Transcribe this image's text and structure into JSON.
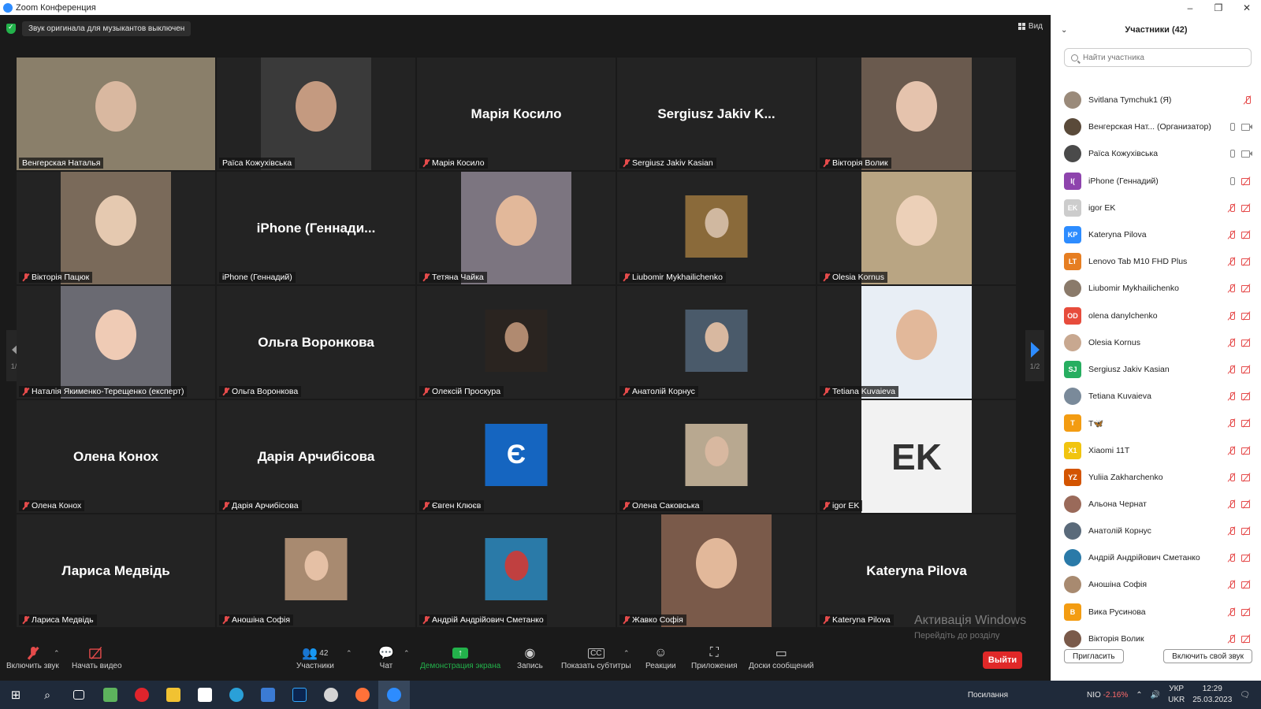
{
  "window": {
    "title": "Zoom Конференция",
    "controls": [
      "–",
      "❐",
      "✕"
    ]
  },
  "notice": "Звук оригинала для музыкантов выключен",
  "view_label": "Вид",
  "tiles": [
    {
      "bigname": "",
      "label": "Венгерская Наталья",
      "muted": false,
      "active": true,
      "photo": "full",
      "bg": "#8a7f6a",
      "face": "#d9b8a0"
    },
    {
      "bigname": "",
      "label": "Раїса Кожухівська",
      "muted": false,
      "photo": "full",
      "bg": "#3a3a3a",
      "face": "#c49a80"
    },
    {
      "bigname": "Марія Косило",
      "label": "Марія Косило",
      "muted": true
    },
    {
      "bigname": "Sergiusz Jakiv K...",
      "label": "Sergiusz Jakiv Kasian",
      "muted": true
    },
    {
      "bigname": "",
      "label": "Вікторія Волик",
      "muted": true,
      "photo": "full",
      "bg": "#6a5a4e",
      "face": "#e5c3ad"
    },
    {
      "bigname": "",
      "label": "Вікторія Пацюк",
      "muted": true,
      "photo": "full",
      "bg": "#7a6a5a",
      "face": "#e5c9b0"
    },
    {
      "bigname": "iPhone (Геннади...",
      "label": "iPhone (Геннадий)",
      "muted": false
    },
    {
      "bigname": "",
      "label": "Тетяна Чайка",
      "muted": true,
      "photo": "full",
      "bg": "#7c7580",
      "face": "#e2b89a"
    },
    {
      "bigname": "",
      "label": "Liubomir Mykhailichenko",
      "muted": true,
      "photo": "small",
      "bg": "#8a6a3a",
      "face": "#d0b8a0"
    },
    {
      "bigname": "",
      "label": "Olesia Kornus",
      "muted": true,
      "photo": "full",
      "bg": "#b9a583",
      "face": "#ecd0b8"
    },
    {
      "bigname": "",
      "label": "Наталія Якименко-Терещенко (експерт)",
      "muted": true,
      "photo": "full",
      "bg": "#6a6a72",
      "face": "#efcbb5"
    },
    {
      "bigname": "Ольга Воронкова",
      "label": "Ольга Воронкова",
      "muted": true
    },
    {
      "bigname": "",
      "label": "Олексій Проскура",
      "muted": true,
      "photo": "small",
      "bg": "#2a2420",
      "face": "#b08a70"
    },
    {
      "bigname": "",
      "label": "Анатолій Корнус",
      "muted": true,
      "photo": "small",
      "bg": "#4a5a6a",
      "face": "#d8b8a0"
    },
    {
      "bigname": "",
      "label": "Tetiana Kuvaieva",
      "muted": true,
      "photo": "full",
      "bg": "#e8eef5",
      "face": "#e2b89a"
    },
    {
      "bigname": "Олена Конох",
      "label": "Олена Конох",
      "muted": true
    },
    {
      "bigname": "Дарія Арчибісова",
      "label": "Дарія Арчибісова",
      "muted": true
    },
    {
      "bigname": "",
      "label": "Євген Клюєв",
      "muted": true,
      "photo": "small",
      "bg": "#1565c0",
      "letter": "Є"
    },
    {
      "bigname": "",
      "label": "Олена Саковська",
      "muted": true,
      "photo": "small",
      "bg": "#b8a890",
      "face": "#d8b8a0"
    },
    {
      "bigname": "",
      "label": "igor EK",
      "muted": true,
      "photo": "full",
      "bg": "#f2f2f2",
      "letter": "EK"
    },
    {
      "bigname": "Лариса Медвідь",
      "label": "Лариса Медвідь",
      "muted": true
    },
    {
      "bigname": "",
      "label": "Аношіна Софія",
      "muted": true,
      "photo": "small",
      "bg": "#a88a70",
      "face": "#e5c0a5"
    },
    {
      "bigname": "",
      "label": "Андрій Андрійович Сметанко",
      "muted": true,
      "photo": "small",
      "bg": "#2a7aa8",
      "face": "#c04040"
    },
    {
      "bigname": "",
      "label": "Жавко Софія",
      "muted": true,
      "photo": "full",
      "bg": "#7a5a4a",
      "face": "#e2b89a"
    },
    {
      "bigname": "Kateryna Pilova",
      "label": "Kateryna Pilova",
      "muted": true
    }
  ],
  "pager": {
    "left": "1/2",
    "right": "1/2"
  },
  "watermark": {
    "title": "Активація Windows",
    "text": "Перейдіть до розділу \"Настройки\", щоб активувати Windows."
  },
  "toolbar": {
    "unmute": "Включить звук",
    "start_video": "Начать видео",
    "participants": "Участники",
    "participants_count": "42",
    "chat": "Чат",
    "share": "Демонстрация экрана",
    "record": "Запись",
    "captions": "Показать субтитры",
    "reactions": "Реакции",
    "apps": "Приложения",
    "whiteboards": "Доски сообщений",
    "leave": "Выйти"
  },
  "panel": {
    "title": "Участники (42)",
    "search_placeholder": "Найти участника",
    "invite": "Пригласить",
    "unmute_me": "Включить свой звук",
    "participants": [
      {
        "name": "Svitlana Tymchuk1 (Я)",
        "initials": "",
        "color": "#9a8a7a",
        "mic": "off",
        "cam": "none"
      },
      {
        "name": "Венгерская Нат... (Организатор)",
        "initials": "",
        "color": "#5a4a3a",
        "mic": "on",
        "cam": "on"
      },
      {
        "name": "Раїса Кожухівська",
        "initials": "",
        "color": "#4a4a4a",
        "mic": "on",
        "cam": "on"
      },
      {
        "name": "iPhone (Геннадий)",
        "initials": "I(",
        "color": "#8e44ad",
        "mic": "on",
        "cam": "off"
      },
      {
        "name": "igor EK",
        "initials": "EK",
        "color": "#cccccc",
        "mic": "off",
        "cam": "off"
      },
      {
        "name": "Kateryna Pilova",
        "initials": "KP",
        "color": "#2d8cff",
        "mic": "off",
        "cam": "off"
      },
      {
        "name": "Lenovo Tab M10 FHD Plus",
        "initials": "LT",
        "color": "#e67e22",
        "mic": "off",
        "cam": "off"
      },
      {
        "name": "Liubomir Mykhailichenko",
        "initials": "",
        "color": "#8a7a6a",
        "mic": "off",
        "cam": "off"
      },
      {
        "name": "olena danylchenko",
        "initials": "OD",
        "color": "#e74c3c",
        "mic": "off",
        "cam": "off"
      },
      {
        "name": "Olesia Kornus",
        "initials": "",
        "color": "#c8a890",
        "mic": "off",
        "cam": "off"
      },
      {
        "name": "Sergiusz Jakiv Kasian",
        "initials": "SJ",
        "color": "#27ae60",
        "mic": "off",
        "cam": "off"
      },
      {
        "name": "Tetiana Kuvaieva",
        "initials": "",
        "color": "#7a8a9a",
        "mic": "off",
        "cam": "off"
      },
      {
        "name": "Т🦋",
        "initials": "T",
        "color": "#f39c12",
        "mic": "off",
        "cam": "off"
      },
      {
        "name": "Xiaomi 11T",
        "initials": "X1",
        "color": "#f1c40f",
        "mic": "off",
        "cam": "off"
      },
      {
        "name": "Yuliia Zakharchenko",
        "initials": "YZ",
        "color": "#d35400",
        "mic": "off",
        "cam": "off"
      },
      {
        "name": "Альона Чернат",
        "initials": "",
        "color": "#9a6a5a",
        "mic": "off",
        "cam": "off"
      },
      {
        "name": "Анатолій Корнус",
        "initials": "",
        "color": "#5a6a7a",
        "mic": "off",
        "cam": "off"
      },
      {
        "name": "Андрій Андрійович Сметанко",
        "initials": "",
        "color": "#2a7aa8",
        "mic": "off",
        "cam": "off"
      },
      {
        "name": "Аношіна Софія",
        "initials": "",
        "color": "#a88a70",
        "mic": "off",
        "cam": "off"
      },
      {
        "name": "Вика Русинова",
        "initials": "B",
        "color": "#f39c12",
        "mic": "off",
        "cam": "off"
      },
      {
        "name": "Вікторія Волик",
        "initials": "",
        "color": "#7a5a4a",
        "mic": "off",
        "cam": "off"
      }
    ]
  },
  "taskbar": {
    "search_label": "Посилання",
    "ticker": "NIO",
    "ticker_change": "-2.16%",
    "lang": "УКР",
    "lang2": "UKR",
    "time": "12:29",
    "date": "25.03.2023"
  }
}
